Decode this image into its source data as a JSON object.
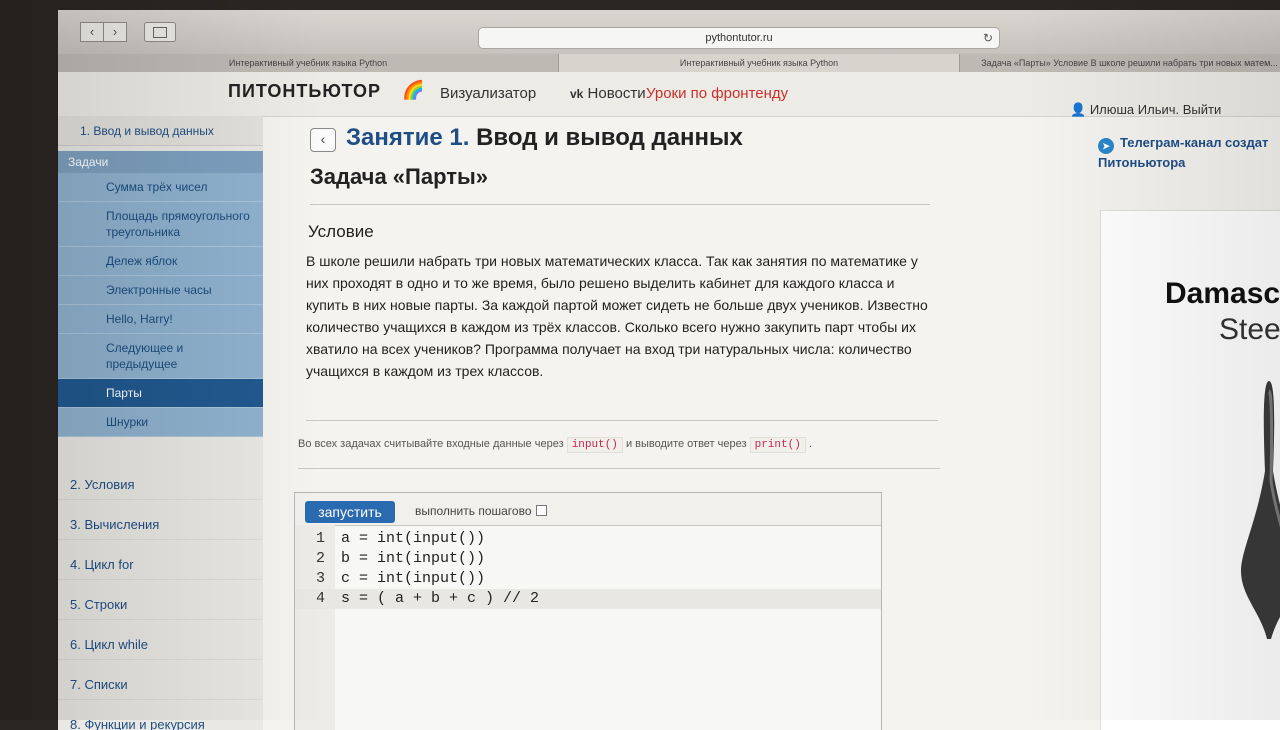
{
  "browser": {
    "url": "pythontutor.ru",
    "tabs": [
      "Интерактивный учебник языка Python",
      "Интерактивный учебник языка Python",
      "Задача «Парты» Условие В школе решили набрать три новых матем..."
    ]
  },
  "site": {
    "logo": "ПИТОНТЬЮТОР",
    "nav": [
      "Визуализатор",
      "Новости",
      "Уроки по фронтенду"
    ],
    "user": "Илюша Ильич. Выйти"
  },
  "sidebar": {
    "current_lesson": "1. Ввод и вывод данных",
    "tasks_heading": "Задачи",
    "tasks": [
      {
        "label": "Сумма трёх чисел"
      },
      {
        "label": "Площадь прямоугольного треугольника"
      },
      {
        "label": "Дележ яблок"
      },
      {
        "label": "Электронные часы"
      },
      {
        "label": "Hello, Harry!"
      },
      {
        "label": "Следующее и предыдущее"
      },
      {
        "label": "Парты"
      },
      {
        "label": "Шнурки"
      }
    ],
    "chapters": [
      "2. Условия",
      "3. Вычисления",
      "4. Цикл for",
      "5. Строки",
      "6. Цикл while",
      "7. Списки",
      "8. Функции и рекурсия"
    ]
  },
  "main": {
    "lesson_prefix": "Занятие 1.",
    "lesson_name": "Ввод и вывод данных",
    "task_title": "Задача «Парты»",
    "condition_heading": "Условие",
    "condition_text": "В школе решили набрать три новых математических класса. Так как занятия по математике у них проходят в одно и то же время, было решено выделить кабинет для каждого класса и купить в них новые парты. За каждой партой может сидеть не больше двух учеников. Известно количество учащихся в каждом из трёх классов. Сколько всего нужно закупить парт чтобы их хватило на всех учеников? Программа получает на вход три натуральных числа: количество учащихся в каждом из трех классов.",
    "io_note_1": "Во всех задачах считывайте входные данные через",
    "io_input": "input()",
    "io_note_2": "и выводите ответ через",
    "io_print": "print()",
    "io_end": "."
  },
  "editor": {
    "run_label": "запустить",
    "step_label": "выполнить пошагово",
    "lines": [
      {
        "n": "1",
        "code": "a = int(input())"
      },
      {
        "n": "2",
        "code": "b = int(input())"
      },
      {
        "n": "3",
        "code": "c = int(input())"
      },
      {
        "n": "4",
        "code": "s = ( a + b + c ) // 2"
      }
    ]
  },
  "right": {
    "telegram_1": "Телеграм-канал создат",
    "telegram_2": "Питоньютора",
    "ad_title": "Damascu",
    "ad_sub": "Steel"
  }
}
